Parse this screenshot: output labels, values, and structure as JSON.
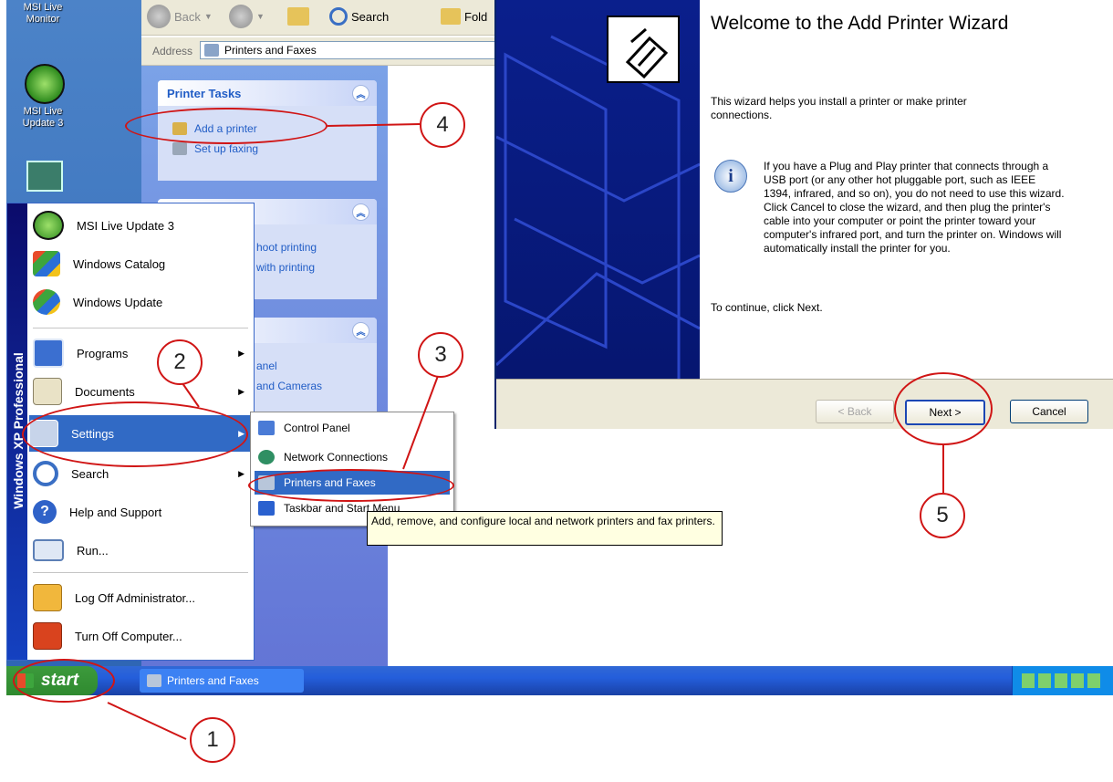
{
  "desktop": {
    "icons": [
      {
        "label": "MSI Live Monitor",
        "icon": "monitor-icon"
      },
      {
        "label": "MSI Live Update 3",
        "icon": "live-update-icon"
      },
      {
        "label": "",
        "icon": "network-icon"
      }
    ]
  },
  "explorer": {
    "toolbar": {
      "back": "Back",
      "search": "Search",
      "folders": "Fold"
    },
    "address": {
      "label": "Address",
      "value": "Printers and Faxes"
    },
    "taskpane": {
      "printer_tasks": {
        "title": "Printer Tasks",
        "items": [
          "Add a printer",
          "Set up faxing"
        ]
      },
      "see_also": {
        "items": [
          "hoot printing",
          "with printing"
        ]
      },
      "other_places": {
        "items": [
          "anel",
          "and Cameras"
        ]
      }
    }
  },
  "wizard": {
    "title": "Welcome to the Add Printer Wizard",
    "intro": "This wizard helps you install a printer or make printer connections.",
    "info": "If you have a Plug and Play printer that connects through a USB port (or any other hot pluggable port, such as IEEE 1394, infrared, and so on), you do not need to use this wizard. Click Cancel to close the wizard, and then plug the printer's cable into your computer or point the printer toward your computer's infrared port, and turn the printer on. Windows will automatically install the printer for you.",
    "continue": "To continue, click Next.",
    "buttons": {
      "back": "< Back",
      "next": "Next >",
      "cancel": "Cancel"
    }
  },
  "start_menu": {
    "strip_text": "Windows XP Professional",
    "pinned": [
      "MSI Live Update 3",
      "Windows Catalog",
      "Windows Update"
    ],
    "items": [
      "Programs",
      "Documents",
      "Settings",
      "Search",
      "Help and Support",
      "Run...",
      "Log Off Administrator...",
      "Turn Off Computer..."
    ]
  },
  "settings_submenu": {
    "items": [
      "Control Panel",
      "Network Connections",
      "Printers and Faxes",
      "Taskbar and Start Menu"
    ]
  },
  "tooltip": "Add, remove, and configure local and network printers and fax printers.",
  "taskbar": {
    "start": "start",
    "task": "Printers and Faxes"
  },
  "callouts": [
    "1",
    "2",
    "3",
    "4",
    "5"
  ],
  "colors": {
    "callout": "#d01515",
    "xp_blue": "#245edb",
    "start_green": "#2f8a2f",
    "highlight": "#316ac5"
  }
}
